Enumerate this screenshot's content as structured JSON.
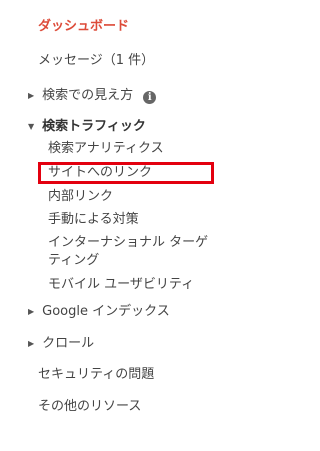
{
  "nav": {
    "dashboard": "ダッシュボード",
    "messages": "メッセージ（1 件）",
    "search_appearance": "検索での見え方",
    "search_traffic": "検索トラフィック",
    "search_traffic_items": [
      "検索アナリティクス",
      "サイトへのリンク",
      "内部リンク",
      "手動による対策",
      "インターナショナル ターゲティング",
      "モバイル ユーザビリティ"
    ],
    "google_index": "Google インデックス",
    "crawl": "クロール",
    "security_issues": "セキュリティの問題",
    "other_resources": "その他のリソース"
  },
  "icons": {
    "collapsed_arrow": "▶",
    "expanded_arrow": "▼",
    "info": "i"
  },
  "colors": {
    "active": "#dd4b39",
    "highlight_box": "#e3000f"
  }
}
